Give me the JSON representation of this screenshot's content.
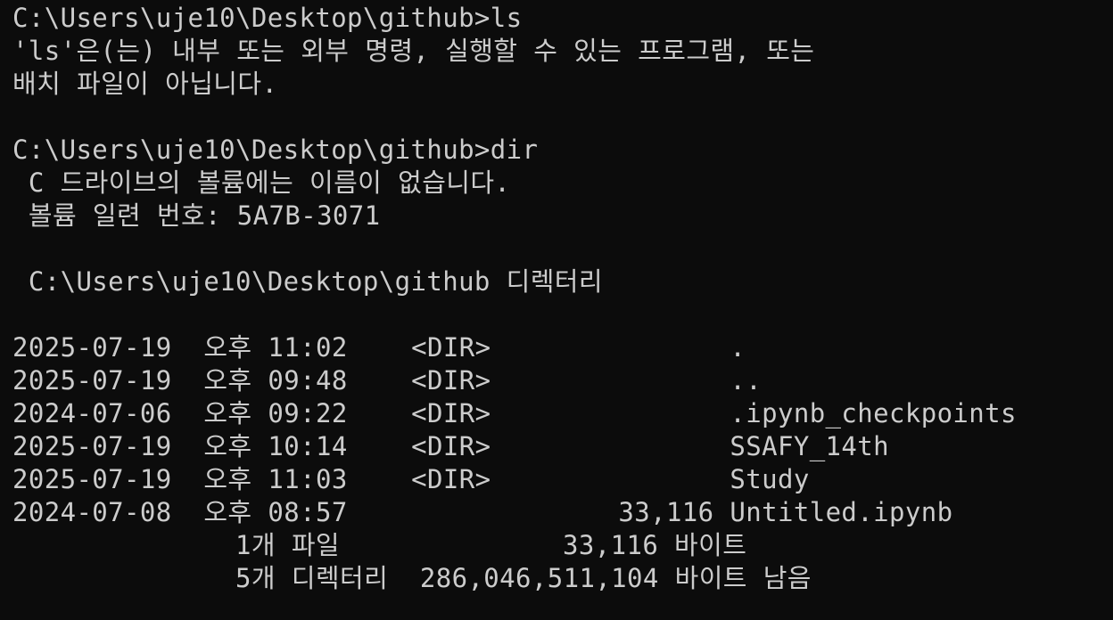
{
  "terminal": {
    "ls": {
      "prompt": "C:\\Users\\uje10\\Desktop\\github>ls",
      "error_1": "'ls'은(는) 내부 또는 외부 명령, 실행할 수 있는 프로그램, 또는",
      "error_2": "배치 파일이 아닙니다."
    },
    "dir": {
      "prompt": "C:\\Users\\uje10\\Desktop\\github>dir",
      "volume_line": " C 드라이브의 볼륨에는 이름이 없습니다.",
      "serial_line": " 볼륨 일련 번호: 5A7B-3071",
      "directory_line": " C:\\Users\\uje10\\Desktop\\github 디렉터리",
      "entries": [
        {
          "date": "2025-07-19",
          "ampm": "오후",
          "time": "11:02",
          "type": "<DIR>",
          "size": "",
          "name": "."
        },
        {
          "date": "2025-07-19",
          "ampm": "오후",
          "time": "09:48",
          "type": "<DIR>",
          "size": "",
          "name": ".."
        },
        {
          "date": "2024-07-06",
          "ampm": "오후",
          "time": "09:22",
          "type": "<DIR>",
          "size": "",
          "name": ".ipynb_checkpoints"
        },
        {
          "date": "2025-07-19",
          "ampm": "오후",
          "time": "10:14",
          "type": "<DIR>",
          "size": "",
          "name": "SSAFY_14th"
        },
        {
          "date": "2025-07-19",
          "ampm": "오후",
          "time": "11:03",
          "type": "<DIR>",
          "size": "",
          "name": "Study"
        },
        {
          "date": "2024-07-08",
          "ampm": "오후",
          "time": "08:57",
          "type": "",
          "size": "33,116",
          "name": "Untitled.ipynb"
        }
      ],
      "summary_files": "              1개 파일              33,116 바이트",
      "summary_dirs": "              5개 디렉터리  286,046,511,104 바이트 남음"
    }
  }
}
